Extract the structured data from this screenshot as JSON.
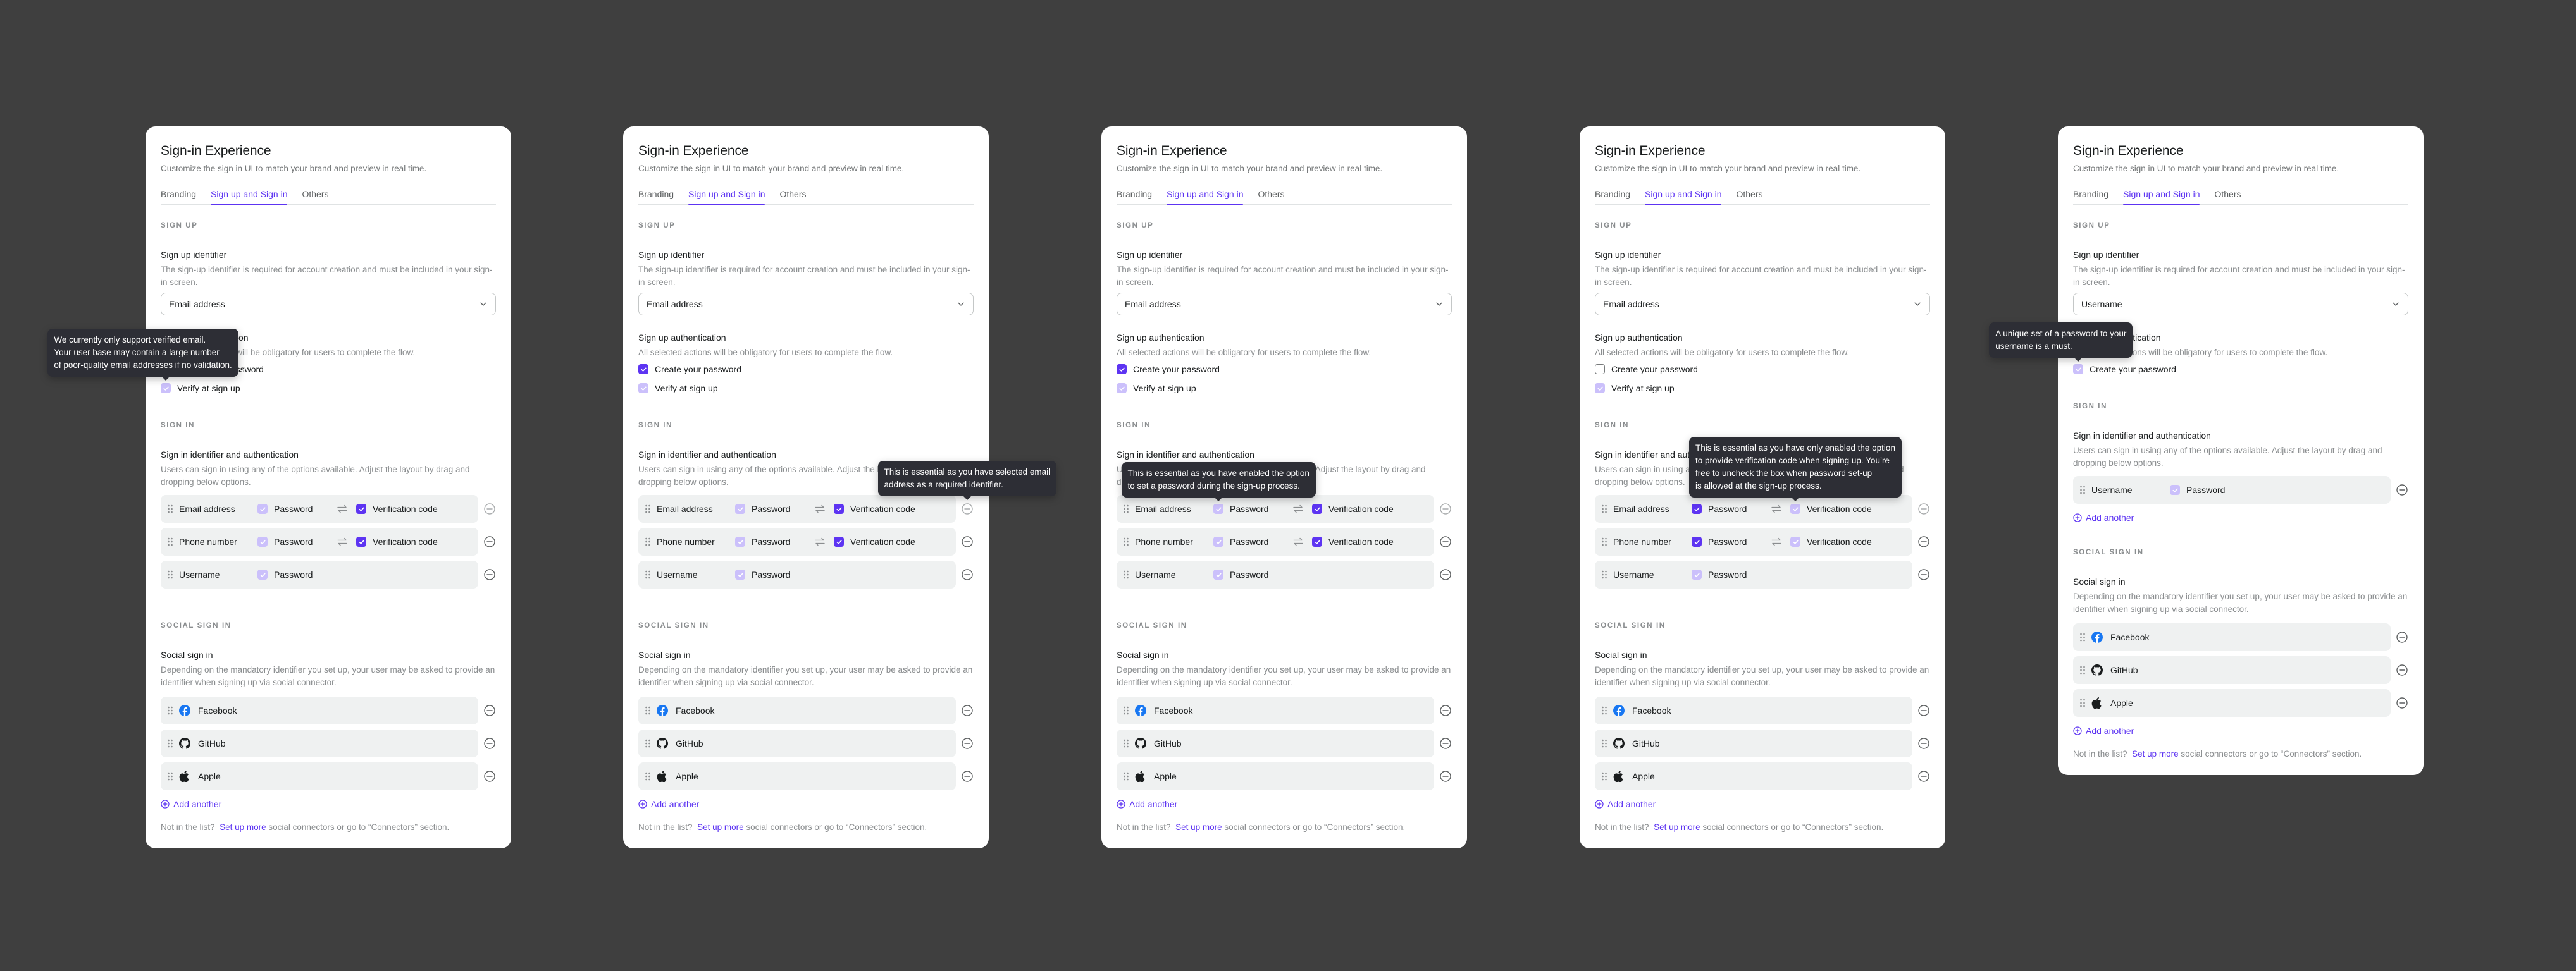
{
  "colors": {
    "background": "#3f3f3f",
    "accent": "#5d34f2",
    "checkbox_disabled": "#cbc0fb",
    "row_bg": "#eff1f1",
    "tooltip_bg": "#2d2e35",
    "facebook": "#1877f2"
  },
  "common": {
    "title": "Sign-in Experience",
    "subtitle": "Customize the sign in UI to match your brand and preview in real time.",
    "tabs": [
      {
        "label": "Branding",
        "active": false
      },
      {
        "label": "Sign up and Sign in",
        "active": true
      },
      {
        "label": "Others",
        "active": false
      }
    ],
    "sign_up_section": "SIGN UP",
    "sign_up_identifier_title": "Sign up identifier",
    "sign_up_identifier_desc": "The sign-up identifier is required for account creation and must be included in your sign-in screen.",
    "sign_up_auth_title": "Sign up authentication",
    "sign_up_auth_desc": "All selected actions will be obligatory for users to complete the flow.",
    "create_password_label": "Create your password",
    "verify_label": "Verify at sign up",
    "sign_in_section": "SIGN IN",
    "sign_in_title": "Sign in identifier and authentication",
    "sign_in_desc": "Users can sign in using any of the options available. Adjust the layout by drag and dropping below options.",
    "password_label": "Password",
    "verification_label": "Verification code",
    "social_section": "SOCIAL SIGN IN",
    "social_title": "Social sign in",
    "social_desc": "Depending on the mandatory identifier you set up, your user may be asked to provide an identifier when signing up via social connector.",
    "add_another": "Add another",
    "footer_prefix": "Not in the list?",
    "footer_link": "Set up more",
    "footer_suffix": "social connectors or go to “Connectors” section.",
    "social_connectors": [
      {
        "name": "Facebook",
        "icon": "facebook-icon"
      },
      {
        "name": "GitHub",
        "icon": "github-icon"
      },
      {
        "name": "Apple",
        "icon": "apple-icon"
      }
    ]
  },
  "panels": [
    {
      "sign_up_identifier": "Email address",
      "create_password": "on",
      "verify_at_sign_up": "disabled",
      "show_sign_up_auth": true,
      "sign_in_add_another": false,
      "sign_in_identifiers": [
        {
          "name": "Email address",
          "password": "disabled",
          "verification": "on"
        },
        {
          "name": "Phone number",
          "password": "disabled",
          "verification": "on"
        },
        {
          "name": "Username",
          "password": "disabled",
          "verification": null
        }
      ],
      "tooltip": {
        "text": "We currently only support verified email.\nYour user base may contain a large number\nof poor-quality email addresses if no validation.",
        "target": "verify"
      }
    },
    {
      "sign_up_identifier": "Email address",
      "create_password": "on",
      "verify_at_sign_up": "disabled",
      "show_sign_up_auth": true,
      "sign_in_add_another": false,
      "sign_in_identifiers": [
        {
          "name": "Email address",
          "password": "disabled",
          "verification": "on"
        },
        {
          "name": "Phone number",
          "password": "disabled",
          "verification": "on"
        },
        {
          "name": "Username",
          "password": "disabled",
          "verification": null
        }
      ],
      "tooltip": {
        "text": "This is essential as you have selected email\naddress as a required identifier.",
        "target": "remove-email"
      }
    },
    {
      "sign_up_identifier": "Email address",
      "create_password": "on",
      "verify_at_sign_up": "disabled",
      "show_sign_up_auth": true,
      "sign_in_add_another": false,
      "sign_in_identifiers": [
        {
          "name": "Email address",
          "password": "disabled",
          "verification": "on"
        },
        {
          "name": "Phone number",
          "password": "disabled",
          "verification": "on"
        },
        {
          "name": "Username",
          "password": "disabled",
          "verification": null
        }
      ],
      "tooltip": {
        "text": "This is essential as you have enabled the option\nto set a password during the sign-up process.",
        "target": "email-password"
      }
    },
    {
      "sign_up_identifier": "Email address",
      "create_password": "off",
      "verify_at_sign_up": "disabled",
      "show_sign_up_auth": true,
      "sign_in_add_another": false,
      "sign_in_identifiers": [
        {
          "name": "Email address",
          "password": "on",
          "verification": "disabled"
        },
        {
          "name": "Phone number",
          "password": "on",
          "verification": "disabled"
        },
        {
          "name": "Username",
          "password": "disabled",
          "verification": null
        }
      ],
      "tooltip": {
        "text": "This is essential as you have only enabled the option\nto provide verification code when signing up. You’re\n free to uncheck the box when password set-up\nis allowed at the sign-up process.",
        "target": "email-verification"
      }
    },
    {
      "sign_up_identifier": "Username",
      "create_password": "disabled",
      "verify_at_sign_up": null,
      "show_sign_up_auth": true,
      "sign_in_add_another": true,
      "sign_in_identifiers": [
        {
          "name": "Username",
          "password": "disabled",
          "verification": null
        }
      ],
      "tooltip": {
        "text": "A unique set of a password to your\n username is a must.",
        "target": "create-password"
      }
    }
  ]
}
